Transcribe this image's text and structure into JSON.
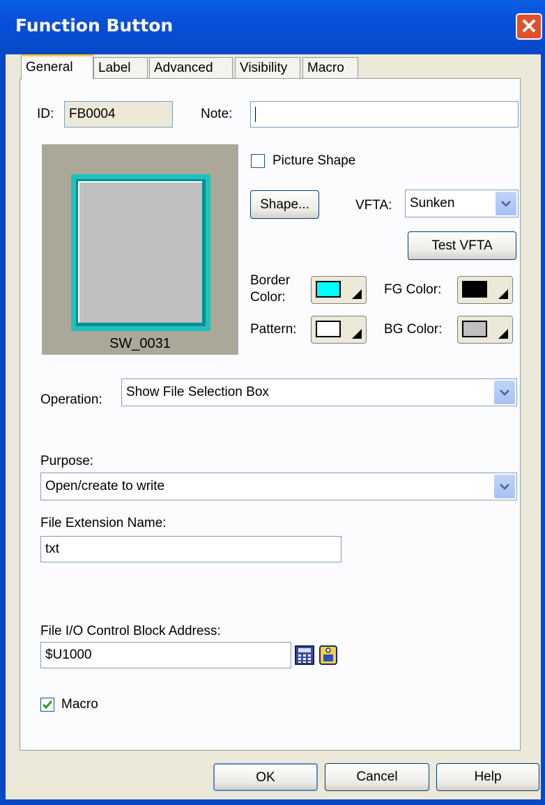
{
  "window": {
    "title": "Function Button",
    "close_icon": "close-icon"
  },
  "tabs": [
    {
      "label": "General",
      "active": true
    },
    {
      "label": "Label"
    },
    {
      "label": "Advanced"
    },
    {
      "label": "Visibility"
    },
    {
      "label": "Macro"
    }
  ],
  "general": {
    "id_label": "ID:",
    "id_value": "FB0004",
    "note_label": "Note:",
    "note_value": "",
    "preview_caption": "SW_0031",
    "picture_shape_label": "Picture Shape",
    "picture_shape_checked": false,
    "shape_button": "Shape...",
    "vfta_label": "VFTA:",
    "vfta_value": "Sunken",
    "test_vfta_button": "Test VFTA",
    "border_color_label": "Border Color:",
    "border_color_label_line1": "Border",
    "border_color_label_line2": "Color:",
    "fg_color_label": "FG Color:",
    "pattern_label": "Pattern:",
    "bg_color_label": "BG Color:",
    "colors": {
      "border": "#00ffff",
      "fg": "#000000",
      "pattern": "#ffffff",
      "bg": "#c0c0c0"
    },
    "operation_label": "Operation:",
    "operation_value": "Show File Selection Box",
    "purpose_label": "Purpose:",
    "purpose_value": "Open/create to write",
    "file_ext_label": "File Extension Name:",
    "file_ext_value": "txt",
    "file_io_label": "File I/O Control Block Address:",
    "file_io_value": "$U1000",
    "macro_label": "Macro",
    "macro_checked": true
  },
  "buttons": {
    "ok": "OK",
    "cancel": "Cancel",
    "help": "Help"
  }
}
